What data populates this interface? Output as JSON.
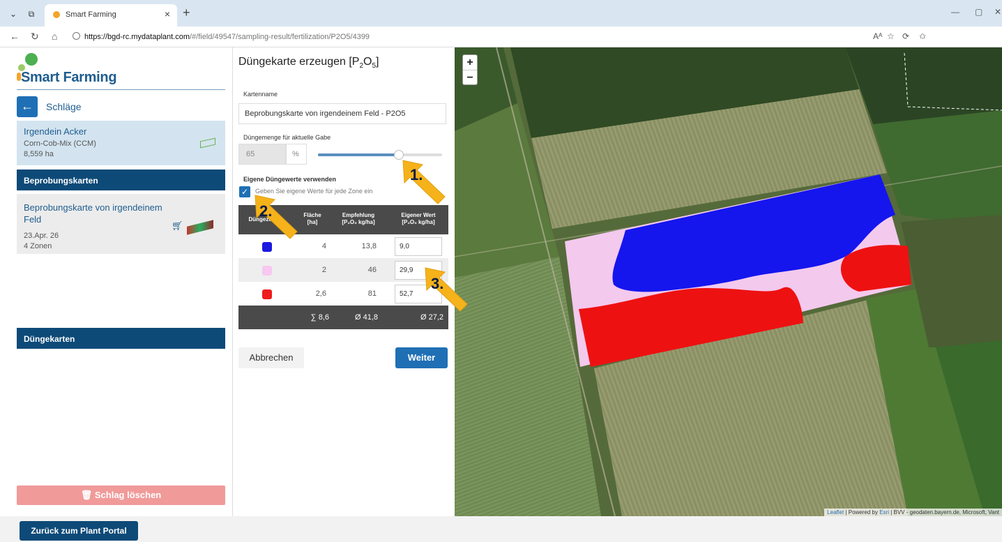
{
  "browser": {
    "tab_title": "Smart Farming",
    "url_host": "https://bgd-rc.mydataplant.com",
    "url_path": "/#/field/49547/sampling-result/fertilization/P2O5/4399"
  },
  "sidebar": {
    "logo_text": "Smart Farming",
    "back_label": "Schläge",
    "field": {
      "name": "Irgendein Acker",
      "crop": "Corn-Cob-Mix (CCM)",
      "area": "8,559 ha"
    },
    "sampling_header": "Beprobungskarten",
    "sampling_card": {
      "name": "Beprobungskarte von irgendeinem Feld",
      "date": "23.Apr. 26",
      "zones": "4 Zonen"
    },
    "fert_header": "Düngekarten",
    "delete_label": "Schlag löschen"
  },
  "panel": {
    "title_prefix": "Düngekarte erzeugen [P",
    "title_sub1": "2",
    "title_mid": "O",
    "title_sub2": "5",
    "title_suffix": "]",
    "name_label": "Kartenname",
    "name_value": "Beprobungskarte von irgendeinem Feld - P2O5",
    "amount_label": "Düngemenge für aktuelle Gabe",
    "amount_value": "65",
    "amount_unit": "%",
    "slider_fraction": 0.65,
    "own_values_label": "Eigene Düngewerte verwenden",
    "own_values_hint": "Geben Sie eigene Werte für jede Zone ein",
    "table": {
      "col_zone": "Düngezone",
      "col_area_1": "Fläche",
      "col_area_2": "[ha]",
      "col_rec_1": "Empfehlung",
      "col_rec_2": "[P₂O₅ kg/ha]",
      "col_own_1": "Eigener Wert",
      "col_own_2": "[P₂O₅ kg/ha]",
      "rows": [
        {
          "color": "#1a1ae0",
          "area": "4",
          "rec": "13,8",
          "own": "9,0"
        },
        {
          "color": "#f7c8f0",
          "area": "2",
          "rec": "46",
          "own": "29,9"
        },
        {
          "color": "#ee1c1c",
          "area": "2,6",
          "rec": "81",
          "own": "52,7"
        }
      ],
      "sum_area": "∑ 8,6",
      "avg_rec": "Ø 41,8",
      "avg_own": "Ø 27,2"
    },
    "cancel_label": "Abbrechen",
    "next_label": "Weiter"
  },
  "map": {
    "zoom_in": "+",
    "zoom_out": "−",
    "attribution_leaflet": "Leaflet",
    "attribution_rest": " | Powered by ",
    "attribution_esri": "Esri",
    "attribution_tail": " | BVV - geodaten.bayern.de, Microsoft, Vant"
  },
  "annotations": {
    "m1": "1.",
    "m2": "2.",
    "m3": "3."
  },
  "footer": {
    "portal_label": "Zurück zum Plant Portal"
  },
  "colors": {
    "primary": "#1f6fb5",
    "header": "#0d4a78",
    "marker": "#f6b21a"
  }
}
